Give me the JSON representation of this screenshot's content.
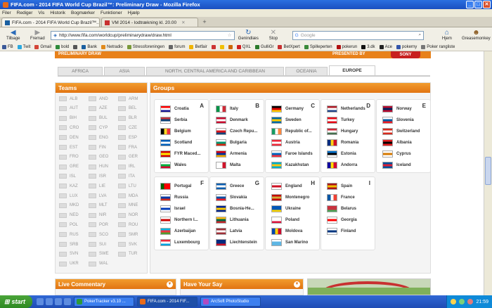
{
  "window": {
    "title": "FIFA.com - 2014 FIFA World Cup Brazil™: Preliminary Draw - Mozilla Firefox"
  },
  "menu": [
    "Filer",
    "Rediger",
    "Vis",
    "Historik",
    "Bogmærker",
    "Funktioner",
    "Hjælp"
  ],
  "tabs": [
    {
      "label": "FIFA.com - 2014 FIFA World Cup Brazil™...",
      "active": true
    },
    {
      "label": "VM 2014 - lodtrækning kl. 20.00",
      "active": false
    }
  ],
  "nav": {
    "back": "Tilbage",
    "forward": "Fremad",
    "url": "http://www.fifa.com/worldcup/preliminarydraw/draw.html",
    "reload": "Genindlæs",
    "stop": "Stop",
    "search_placeholder": "Google",
    "home": "Hjem",
    "greasemonkey": "Greasemonkey"
  },
  "bookmarks": [
    {
      "label": "FB",
      "color": "#3b5998"
    },
    {
      "label": "Twit",
      "color": "#2aa9e0"
    },
    {
      "label": "Gmail",
      "color": "#d44638"
    },
    {
      "label": "bold",
      "color": "#2e8b3a"
    },
    {
      "label": "",
      "color": "#555555"
    },
    {
      "label": "Bank",
      "color": "#1a5fa0"
    },
    {
      "label": "Netradio",
      "color": "#e08a1a"
    },
    {
      "label": "Stressforeningen",
      "color": "#7a9a3a"
    },
    {
      "label": "forum",
      "color": "#666666"
    },
    {
      "label": "Betfair",
      "color": "#f0b400"
    },
    {
      "label": "",
      "color": "#cc3333"
    },
    {
      "label": "",
      "color": "#f0c000"
    },
    {
      "label": "",
      "color": "#cc6600"
    },
    {
      "label": "QXL",
      "color": "#d02020"
    },
    {
      "label": "GulliGr",
      "color": "#2a7a2a"
    },
    {
      "label": "BetXpert",
      "color": "#c83030"
    },
    {
      "label": "Spilleperten",
      "color": "#3a8a3a"
    },
    {
      "label": "pokerun",
      "color": "#b01010"
    },
    {
      "label": "3.dk",
      "color": "#111111"
    },
    {
      "label": "Ace",
      "color": "#222222"
    },
    {
      "label": "pokerny",
      "color": "#3355aa"
    },
    {
      "label": "Poker rangliste",
      "color": "#777777"
    }
  ],
  "page": {
    "top_strip_left": "PRELIMINARY DRAW",
    "top_strip_right": "PRESENTED BY",
    "sponsor": "SONY",
    "confed_tabs": [
      {
        "label": "AFRICA",
        "active": false
      },
      {
        "label": "ASIA",
        "active": false
      },
      {
        "label": "NORTH, CENTRAL AMERICA AND CARIBBEAN",
        "active": false
      },
      {
        "label": "OCEANIA",
        "active": false
      },
      {
        "label": "EUROPE",
        "active": true
      }
    ],
    "teams_title": "Teams",
    "groups_title": "Groups",
    "teams": [
      "ALB",
      "AND",
      "ARM",
      "AUT",
      "AZE",
      "BEL",
      "BIH",
      "BUL",
      "BLR",
      "CRO",
      "CYP",
      "CZE",
      "DEN",
      "ENG",
      "ESP",
      "EST",
      "FIN",
      "FRA",
      "FRO",
      "GEO",
      "GER",
      "GRE",
      "HUN",
      "IRL",
      "ISL",
      "ISR",
      "ITA",
      "KAZ",
      "LIE",
      "LTU",
      "LUX",
      "LVA",
      "MDA",
      "MKD",
      "MLT",
      "MNE",
      "NED",
      "NIR",
      "NOR",
      "POL",
      "POR",
      "ROU",
      "RUS",
      "SCO",
      "SMR",
      "SRB",
      "SUI",
      "SVK",
      "SVN",
      "SWE",
      "TUR",
      "UKR",
      "WAL"
    ],
    "groups": [
      {
        "letter": "A",
        "teams": [
          {
            "name": "Croatia",
            "flag": [
              "#ff0000",
              "#ffffff",
              "#171796"
            ]
          },
          {
            "name": "Serbia",
            "flag": [
              "#c6363c",
              "#0c4076",
              "#ffffff"
            ]
          },
          {
            "name": "Belgium",
            "flag": [
              "#000000",
              "#fdda24",
              "#ef3340"
            ],
            "v": true
          },
          {
            "name": "Scotland",
            "flag": [
              "#005eb8",
              "#ffffff",
              "#005eb8"
            ]
          },
          {
            "name": "FYR Maced...",
            "flag": [
              "#d20000",
              "#ffe600",
              "#d20000"
            ]
          },
          {
            "name": "Wales",
            "flag": [
              "#ffffff",
              "#00b140",
              "#d30731"
            ]
          }
        ]
      },
      {
        "letter": "B",
        "teams": [
          {
            "name": "Italy",
            "flag": [
              "#009246",
              "#ffffff",
              "#ce2b37"
            ],
            "v": true
          },
          {
            "name": "Denmark",
            "flag": [
              "#c60c30",
              "#ffffff",
              "#c60c30"
            ]
          },
          {
            "name": "Czech Repu...",
            "flag": [
              "#ffffff",
              "#d7141a",
              "#11457e"
            ]
          },
          {
            "name": "Bulgaria",
            "flag": [
              "#ffffff",
              "#00966e",
              "#d62612"
            ]
          },
          {
            "name": "Armenia",
            "flag": [
              "#d90012",
              "#0033a0",
              "#f2a800"
            ]
          },
          {
            "name": "Malta",
            "flag": [
              "#ffffff",
              "#ffffff",
              "#cf142b"
            ],
            "v": true
          }
        ]
      },
      {
        "letter": "C",
        "teams": [
          {
            "name": "Germany",
            "flag": [
              "#000000",
              "#dd0000",
              "#ffce00"
            ]
          },
          {
            "name": "Sweden",
            "flag": [
              "#006aa7",
              "#fecc00",
              "#006aa7"
            ]
          },
          {
            "name": "Republic of...",
            "flag": [
              "#169b62",
              "#ffffff",
              "#ff883e"
            ],
            "v": true
          },
          {
            "name": "Austria",
            "flag": [
              "#ed2939",
              "#ffffff",
              "#ed2939"
            ]
          },
          {
            "name": "Faroe Islands",
            "flag": [
              "#ffffff",
              "#0065bd",
              "#ef303e"
            ]
          },
          {
            "name": "Kazakhstan",
            "flag": [
              "#00afca",
              "#fec50c",
              "#00afca"
            ]
          }
        ]
      },
      {
        "letter": "D",
        "teams": [
          {
            "name": "Netherlands",
            "flag": [
              "#ae1c28",
              "#ffffff",
              "#21468b"
            ]
          },
          {
            "name": "Turkey",
            "flag": [
              "#e30a17",
              "#ffffff",
              "#e30a17"
            ]
          },
          {
            "name": "Hungary",
            "flag": [
              "#ce2939",
              "#ffffff",
              "#477050"
            ]
          },
          {
            "name": "Romania",
            "flag": [
              "#002b7f",
              "#fcd116",
              "#ce1126"
            ],
            "v": true
          },
          {
            "name": "Estonia",
            "flag": [
              "#0072ce",
              "#000000",
              "#ffffff"
            ]
          },
          {
            "name": "Andorra",
            "flag": [
              "#10069f",
              "#fedd00",
              "#d50032"
            ],
            "v": true
          }
        ]
      },
      {
        "letter": "E",
        "teams": [
          {
            "name": "Norway",
            "flag": [
              "#ba0c2f",
              "#00205b",
              "#ba0c2f"
            ]
          },
          {
            "name": "Slovenia",
            "flag": [
              "#ffffff",
              "#005da4",
              "#ed1c24"
            ]
          },
          {
            "name": "Switzerland",
            "flag": [
              "#d52b1e",
              "#ffffff",
              "#d52b1e"
            ]
          },
          {
            "name": "Albania",
            "flag": [
              "#e41e20",
              "#000000",
              "#e41e20"
            ]
          },
          {
            "name": "Cyprus",
            "flag": [
              "#ffffff",
              "#d57800",
              "#ffffff"
            ]
          },
          {
            "name": "Iceland",
            "flag": [
              "#02529c",
              "#dc1e35",
              "#02529c"
            ]
          }
        ]
      },
      {
        "letter": "F",
        "teams": [
          {
            "name": "Portugal",
            "flag": [
              "#006600",
              "#ff0000",
              "#ff0000"
            ],
            "v": true
          },
          {
            "name": "Russia",
            "flag": [
              "#ffffff",
              "#0039a6",
              "#d52b1e"
            ]
          },
          {
            "name": "Israel",
            "flag": [
              "#ffffff",
              "#0038b8",
              "#ffffff"
            ]
          },
          {
            "name": "Northern I...",
            "flag": [
              "#ffffff",
              "#cc0000",
              "#ffffff"
            ]
          },
          {
            "name": "Azerbaijan",
            "flag": [
              "#00b5e2",
              "#ef3340",
              "#509e2f"
            ]
          },
          {
            "name": "Luxembourg",
            "flag": [
              "#ed2939",
              "#ffffff",
              "#00a1de"
            ]
          }
        ]
      },
      {
        "letter": "G",
        "teams": [
          {
            "name": "Greece",
            "flag": [
              "#0d5eaf",
              "#ffffff",
              "#0d5eaf"
            ]
          },
          {
            "name": "Slovakia",
            "flag": [
              "#ffffff",
              "#0b4ea2",
              "#ee1c25"
            ]
          },
          {
            "name": "Bosnia-He...",
            "flag": [
              "#002395",
              "#fecb00",
              "#002395"
            ]
          },
          {
            "name": "Lithuania",
            "flag": [
              "#fdb913",
              "#006a44",
              "#c1272d"
            ]
          },
          {
            "name": "Latvia",
            "flag": [
              "#9e3039",
              "#ffffff",
              "#9e3039"
            ]
          },
          {
            "name": "Liechtenstein",
            "flag": [
              "#002b7f",
              "#002b7f",
              "#ce1126"
            ]
          }
        ]
      },
      {
        "letter": "H",
        "teams": [
          {
            "name": "England",
            "flag": [
              "#ffffff",
              "#ce1124",
              "#ffffff"
            ]
          },
          {
            "name": "Montenegro",
            "flag": [
              "#c40308",
              "#d3ae3b",
              "#c40308"
            ]
          },
          {
            "name": "Ukraine",
            "flag": [
              "#0057b7",
              "#0057b7",
              "#ffd700"
            ]
          },
          {
            "name": "Poland",
            "flag": [
              "#ffffff",
              "#ffffff",
              "#dc143c"
            ]
          },
          {
            "name": "Moldova",
            "flag": [
              "#0046ae",
              "#ffd200",
              "#cc092f"
            ],
            "v": true
          },
          {
            "name": "San Marino",
            "flag": [
              "#ffffff",
              "#5eb6e4",
              "#5eb6e4"
            ]
          }
        ]
      },
      {
        "letter": "I",
        "teams": [
          {
            "name": "Spain",
            "flag": [
              "#aa151b",
              "#f1bf00",
              "#aa151b"
            ]
          },
          {
            "name": "France",
            "flag": [
              "#0055a4",
              "#ffffff",
              "#ef4135"
            ],
            "v": true
          },
          {
            "name": "Belarus",
            "flag": [
              "#c8313e",
              "#c8313e",
              "#4aa657"
            ]
          },
          {
            "name": "Georgia",
            "flag": [
              "#ffffff",
              "#ff0000",
              "#ffffff"
            ]
          },
          {
            "name": "Finland",
            "flag": [
              "#ffffff",
              "#003580",
              "#ffffff"
            ]
          }
        ]
      }
    ],
    "live_commentary": "Live Commentary",
    "have_your_say": "Have Your Say"
  },
  "taskbar": {
    "start": "start",
    "tasks": [
      {
        "label": "PokerTracker v3.10 ...",
        "active": false
      },
      {
        "label": "FIFA.com - 2014 FIF...",
        "active": true
      },
      {
        "label": "ArcSoft PhotoStudio",
        "active": false
      }
    ],
    "clock": "21:59"
  }
}
